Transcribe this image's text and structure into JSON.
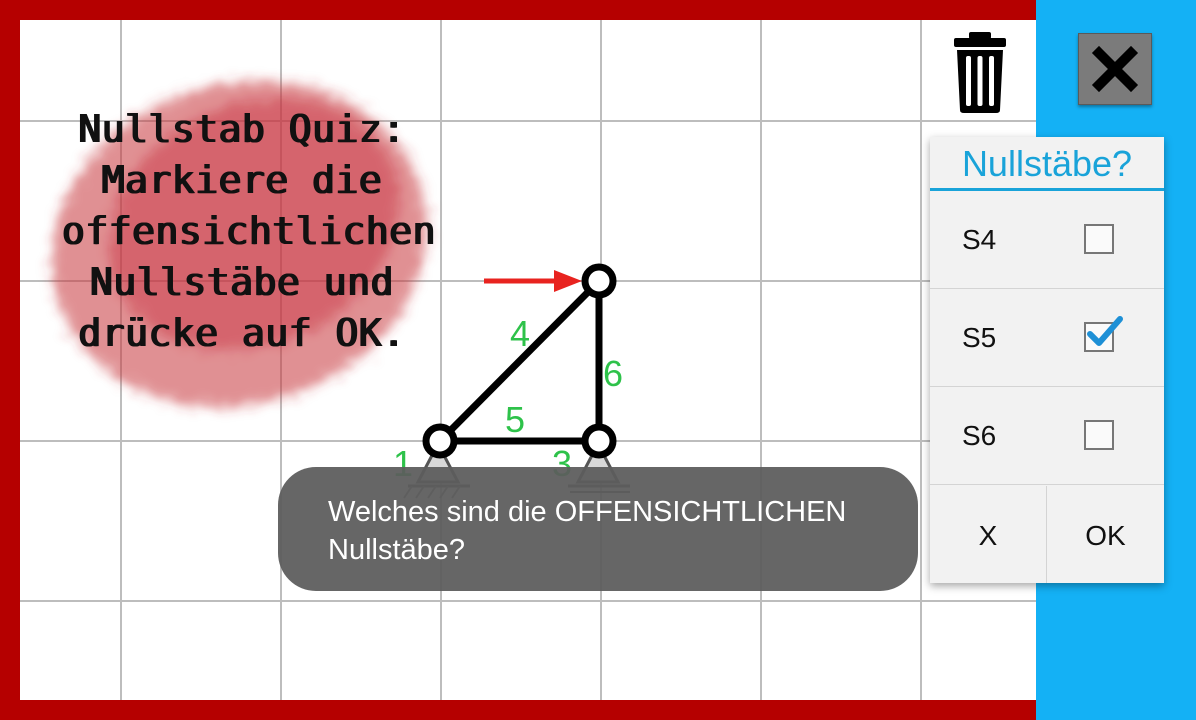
{
  "quiz": {
    "lines": [
      "Nullstab Quiz:",
      "Markiere die",
      "offensichtlichen",
      "Nullstäbe und",
      "drücke auf OK."
    ]
  },
  "truss": {
    "member_labels": [
      "1",
      "3",
      "4",
      "5",
      "6"
    ]
  },
  "panel": {
    "title": "Nullstäbe?",
    "items": [
      {
        "label": "S4",
        "checked": false
      },
      {
        "label": "S5",
        "checked": true
      },
      {
        "label": "S6",
        "checked": false
      }
    ],
    "cancel_label": "X",
    "ok_label": "OK"
  },
  "toast": {
    "message": "Welches sind die OFFENSICHTLICHEN Nullstäbe?"
  },
  "colors": {
    "frame": "#b50000",
    "sidebar": "#14b1f5",
    "accent": "#19a3d9",
    "member_numbers": "#2ec24a",
    "force_arrow": "#e8231f"
  },
  "icons": {
    "trash": "trash-icon",
    "close": "close-icon",
    "check": "checkmark-icon"
  }
}
